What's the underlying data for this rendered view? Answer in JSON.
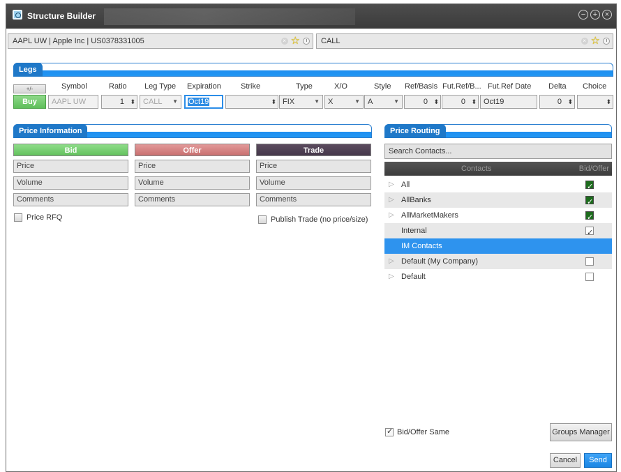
{
  "window": {
    "title": "Structure Builder"
  },
  "symbol_bar": {
    "left_text": "AAPL UW | Apple Inc | US0378331005",
    "right_text": "CALL"
  },
  "legs": {
    "section_title": "Legs",
    "toggle_label": "+/-",
    "columns": [
      "Symbol",
      "Ratio",
      "Leg Type",
      "Expiration",
      "Strike",
      "Type",
      "X/O",
      "Style",
      "Ref/Basis",
      "Fut.Ref/B...",
      "Fut.Ref Date",
      "Delta",
      "Choice"
    ],
    "row": {
      "side": "Buy",
      "symbol": "AAPL UW",
      "ratio": "1",
      "leg_type": "CALL",
      "expiration": "Oct19",
      "strike": "",
      "type": "FIX",
      "xo": "X",
      "style": "A",
      "ref_basis": "0",
      "fut_ref_basis": "0",
      "fut_ref_date": "Oct19",
      "delta": "0",
      "choice": ""
    }
  },
  "price_information": {
    "section_title": "Price Information",
    "bid": {
      "header": "Bid",
      "price": "Price",
      "volume": "Volume",
      "comments": "Comments"
    },
    "offer": {
      "header": "Offer",
      "price": "Price",
      "volume": "Volume",
      "comments": "Comments"
    },
    "trade": {
      "header": "Trade",
      "price": "Price",
      "volume": "Volume",
      "comments": "Comments"
    },
    "price_rfq_label": "Price RFQ",
    "publish_trade_label": "Publish Trade (no price/size)"
  },
  "price_routing": {
    "section_title": "Price Routing",
    "search_placeholder": "Search Contacts...",
    "col_contacts": "Contacts",
    "col_bid_offer": "Bid/Offer",
    "contacts": [
      {
        "name": "All",
        "expandable": true,
        "checked": true
      },
      {
        "name": "AllBanks",
        "expandable": true,
        "checked": true
      },
      {
        "name": "AllMarketMakers",
        "expandable": true,
        "checked": true
      },
      {
        "name": "Internal",
        "expandable": false,
        "checked": false
      },
      {
        "name": "IM Contacts",
        "expandable": false,
        "checked": false,
        "selected": true
      },
      {
        "name": "Default (My Company)",
        "expandable": true,
        "checked": false
      },
      {
        "name": "Default",
        "expandable": true,
        "checked": false
      }
    ],
    "bid_offer_same_label": "Bid/Offer Same",
    "groups_manager_label": "Groups Manager"
  },
  "footer": {
    "cancel_label": "Cancel",
    "send_label": "Send"
  },
  "colors": {
    "accent": "#2196f3",
    "bid": "#63c15d",
    "offer": "#c86f6f",
    "trade": "#45374a"
  }
}
